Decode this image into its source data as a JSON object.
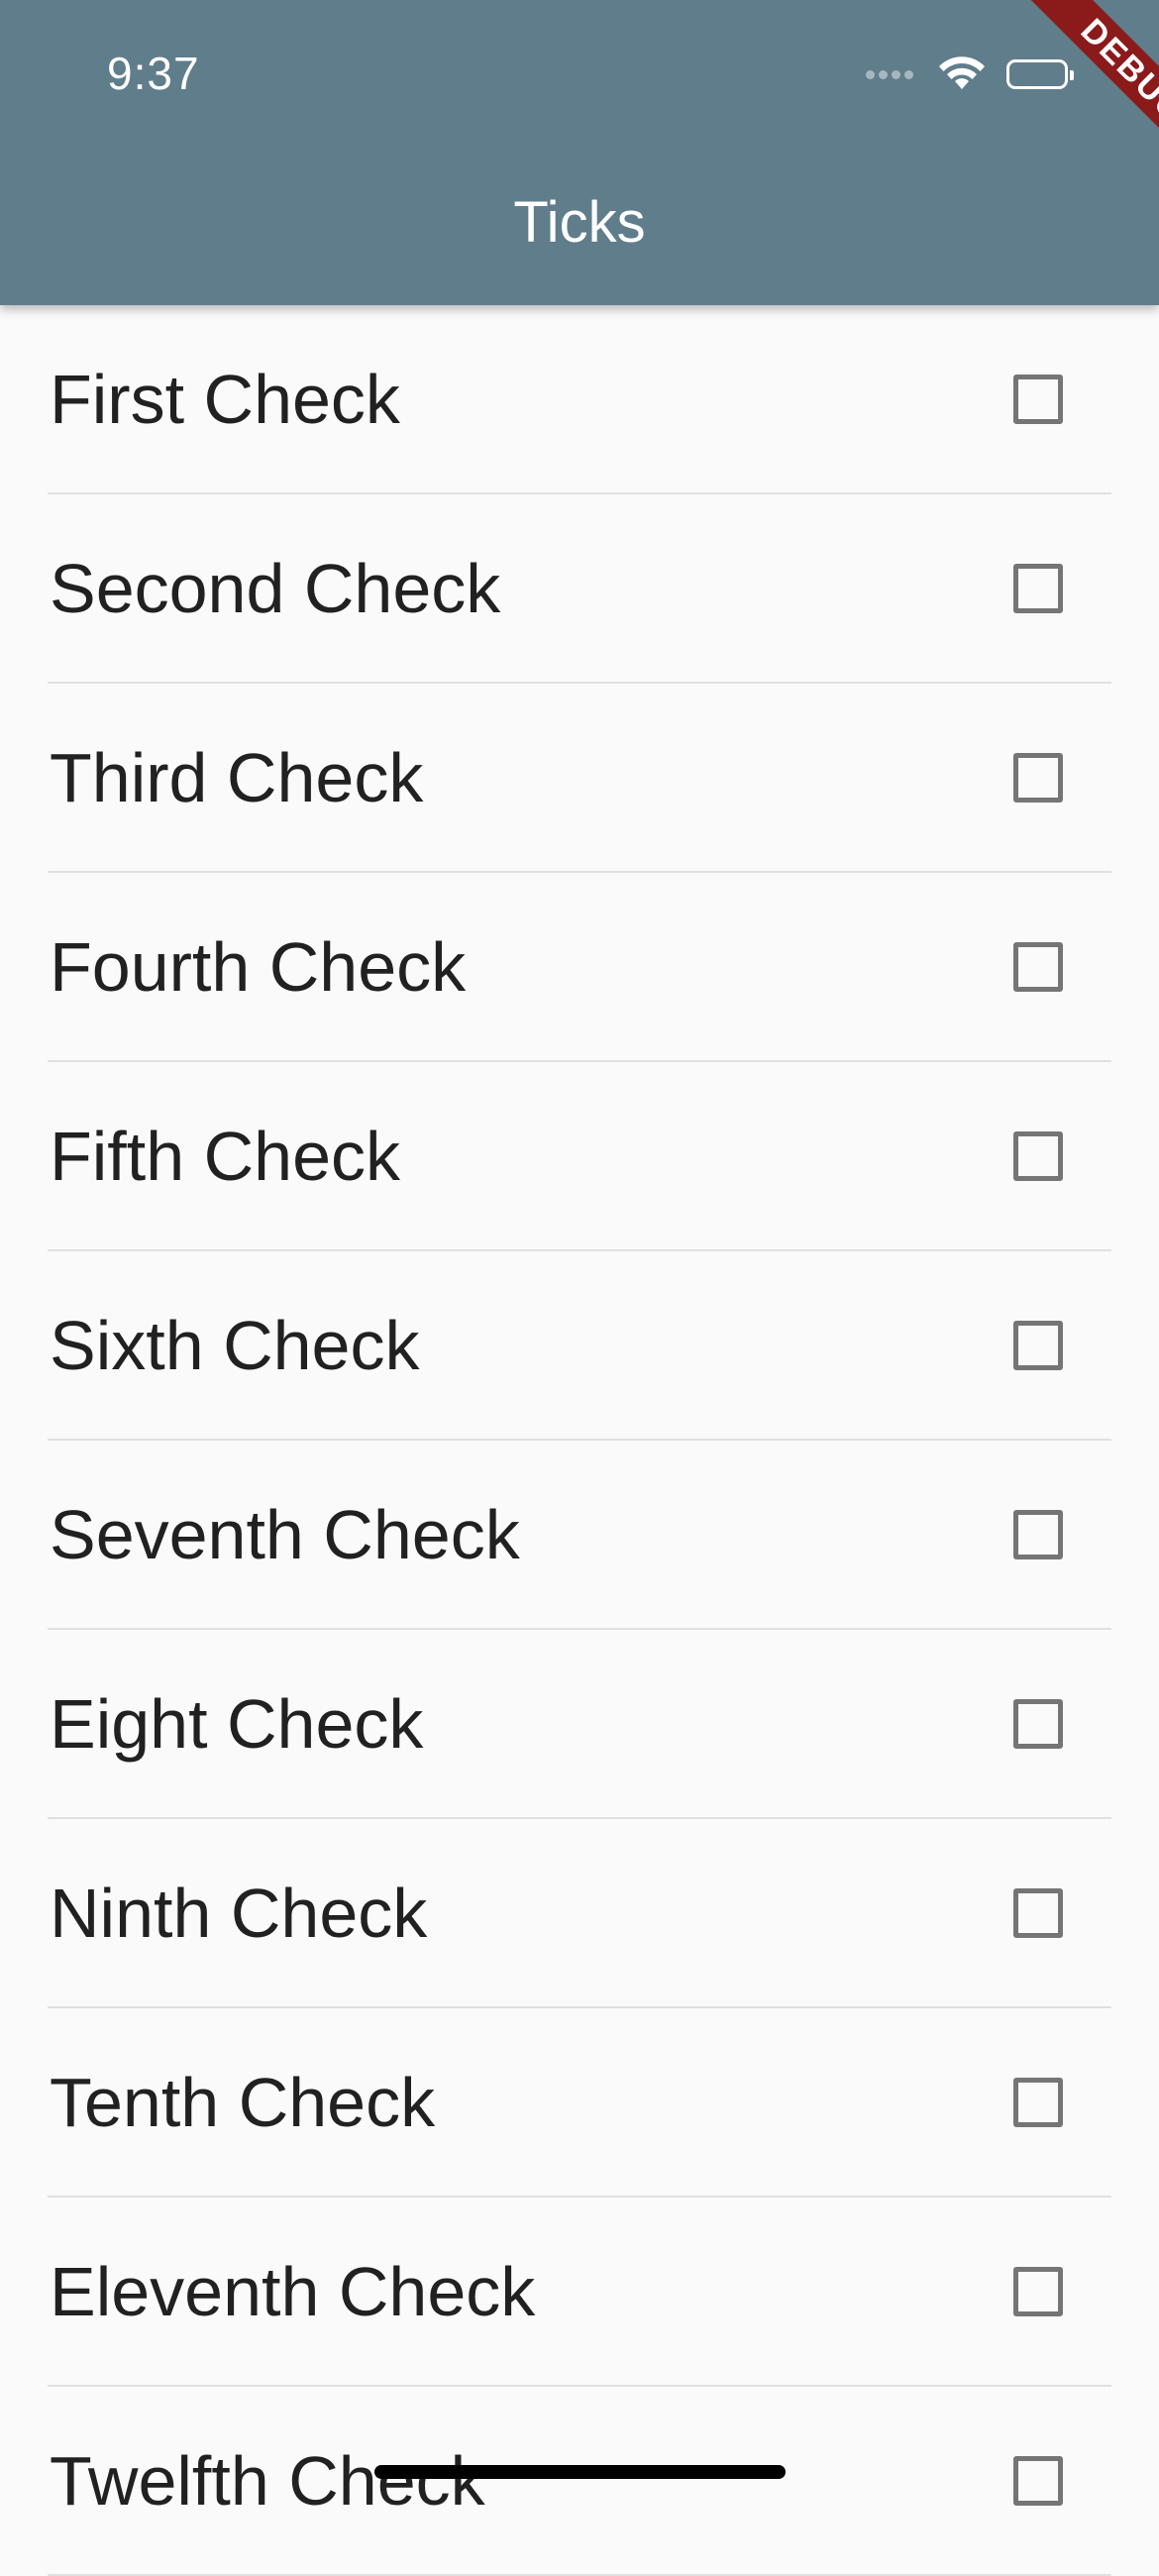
{
  "status_bar": {
    "time": "9:37"
  },
  "app_bar": {
    "title": "Ticks",
    "color": "#607d8b"
  },
  "debug_banner": {
    "label": "DEBUG"
  },
  "checklist": [
    {
      "label": "First Check",
      "checked": false
    },
    {
      "label": "Second Check",
      "checked": false
    },
    {
      "label": "Third Check",
      "checked": false
    },
    {
      "label": "Fourth Check",
      "checked": false
    },
    {
      "label": "Fifth Check",
      "checked": false
    },
    {
      "label": "Sixth Check",
      "checked": false
    },
    {
      "label": "Seventh Check",
      "checked": false
    },
    {
      "label": "Eight Check",
      "checked": false
    },
    {
      "label": "Ninth Check",
      "checked": false
    },
    {
      "label": "Tenth Check",
      "checked": false
    },
    {
      "label": "Eleventh Check",
      "checked": false
    },
    {
      "label": "Twelfth Check",
      "checked": false
    }
  ]
}
